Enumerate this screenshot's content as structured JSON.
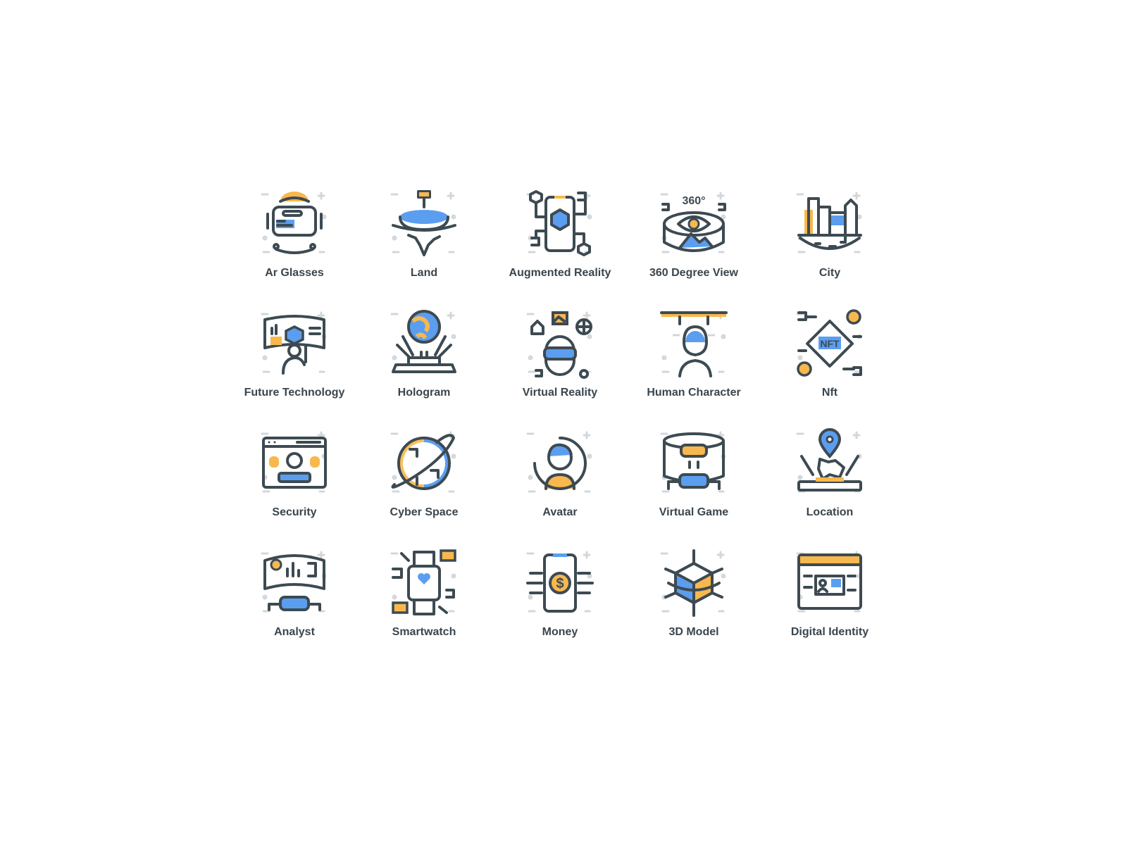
{
  "colors": {
    "stroke": "#3d4a52",
    "accent_orange": "#f8b84e",
    "accent_blue": "#5b9ef0",
    "decor": "#d3d7da",
    "label": "#3a454d"
  },
  "icons": [
    {
      "label": "Ar Glasses",
      "icon": "ar-glasses-icon"
    },
    {
      "label": "Land",
      "icon": "land-icon"
    },
    {
      "label": "Augmented Reality",
      "icon": "augmented-reality-icon"
    },
    {
      "label": "360 Degree View",
      "icon": "360-degree-view-icon",
      "icon_text": "360°"
    },
    {
      "label": "City",
      "icon": "city-icon"
    },
    {
      "label": "Future Technology",
      "icon": "future-technology-icon"
    },
    {
      "label": "Hologram",
      "icon": "hologram-icon"
    },
    {
      "label": "Virtual Reality",
      "icon": "virtual-reality-icon"
    },
    {
      "label": "Human Character",
      "icon": "human-character-icon"
    },
    {
      "label": "Nft",
      "icon": "nft-icon",
      "icon_text": "NFT"
    },
    {
      "label": "Security",
      "icon": "security-icon"
    },
    {
      "label": "Cyber Space",
      "icon": "cyber-space-icon"
    },
    {
      "label": "Avatar",
      "icon": "avatar-icon"
    },
    {
      "label": "Virtual Game",
      "icon": "virtual-game-icon"
    },
    {
      "label": "Location",
      "icon": "location-icon"
    },
    {
      "label": "Analyst",
      "icon": "analyst-icon"
    },
    {
      "label": "Smartwatch",
      "icon": "smartwatch-icon"
    },
    {
      "label": "Money",
      "icon": "money-icon",
      "icon_text": "$"
    },
    {
      "label": "3D Model",
      "icon": "3d-model-icon"
    },
    {
      "label": "Digital Identity",
      "icon": "digital-identity-icon"
    }
  ]
}
